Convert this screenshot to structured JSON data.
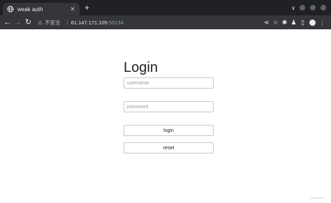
{
  "browser": {
    "tab_title": "weak auth",
    "new_tab_symbol": "+",
    "tabs_dropdown_symbol": "∨",
    "address": {
      "security_label": "不安全",
      "host": "61.147.171.105",
      "port": ":55134"
    },
    "icons": [
      "globe-icon",
      "close-icon",
      "back-arrow-icon",
      "forward-arrow-icon",
      "reload-icon",
      "warning-icon",
      "share-icon",
      "star-icon",
      "extensions-icon",
      "side-panel-icon",
      "profile-avatar-icon",
      "menu-kebab-icon"
    ],
    "window_dot_colors": [
      "#5f6368",
      "#5f6368",
      "#5f6368"
    ]
  },
  "page": {
    "heading": "Login",
    "username_placeholder": "username",
    "password_placeholder": "password",
    "login_label": "login",
    "reset_label": "reset"
  },
  "watermark": "CSDN·Kuj..."
}
